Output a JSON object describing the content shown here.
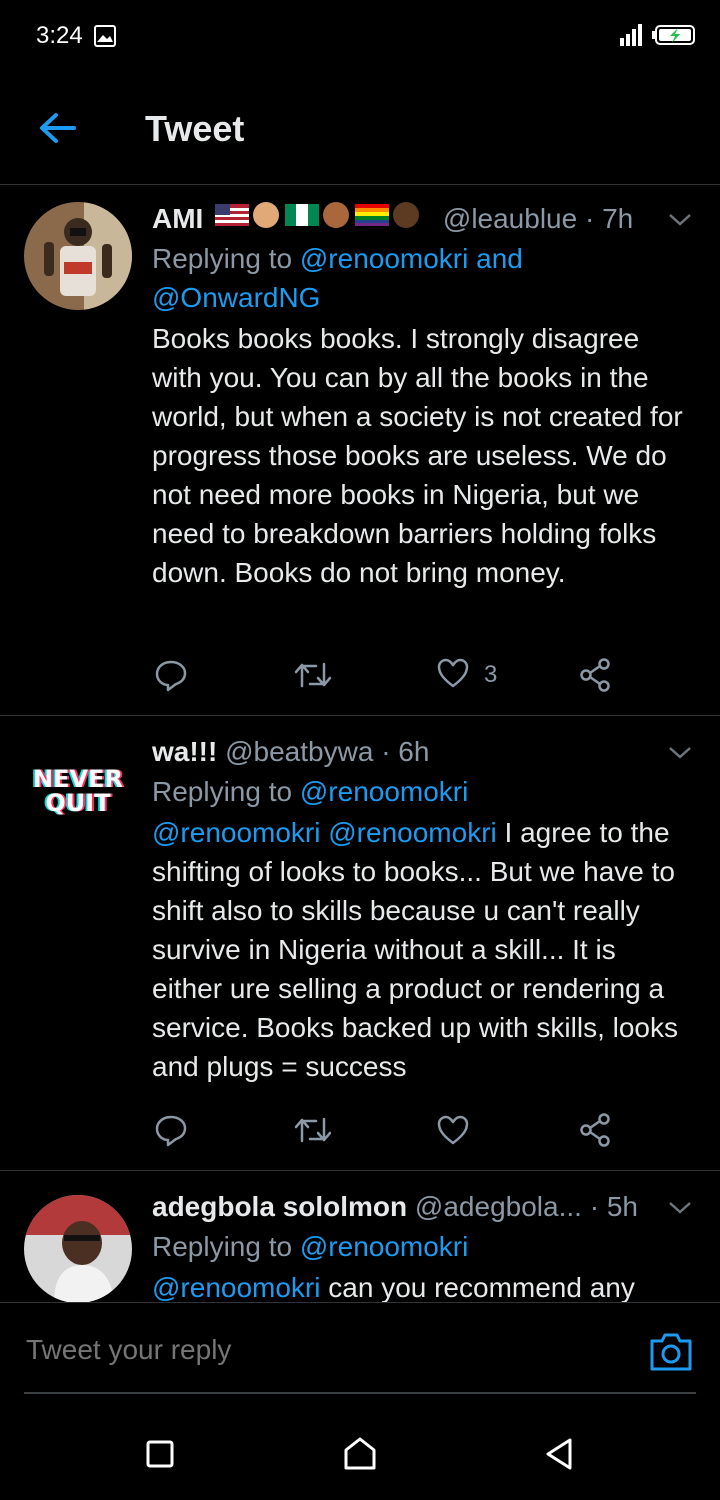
{
  "status_bar": {
    "time": "3:24"
  },
  "header": {
    "title": "Tweet"
  },
  "tweets": [
    {
      "name": "AMI",
      "handle": "@leaublue",
      "separator": "·",
      "time": "7h",
      "replying_prefix": "Replying to",
      "replying_to": "@renoomokri and\n@OnwardNG",
      "body": "Books books books. I strongly disagree with you. You can by all the books in the world, but when a society is not created for progress those books are useless. We do not need more books in Nigeria, but we need to breakdown barriers holding folks down. Books do not bring money.",
      "like_count": "3",
      "avatar_icon": "person-photo-avatar"
    },
    {
      "name": "wa!!!",
      "handle": "@beatbywa",
      "separator": "·",
      "time": "6h",
      "replying_prefix": "Replying to",
      "replying_to": "@renoomokri",
      "body_mention": "@renoomokri @renoomokri",
      "body": " I agree to the shifting of looks to books... But we have to shift also to skills because u can't really survive in Nigeria without a skill... It is either ure selling a product or rendering a service. Books backed up with skills, looks and plugs = success",
      "avatar_text": [
        "NEVER",
        "QUIT"
      ]
    },
    {
      "name": "adegbola sololmon",
      "handle": "@adegbola...",
      "separator": "·",
      "time": "5h",
      "replying_prefix": "Replying to",
      "replying_to": "@renoomokri",
      "body_mention": "@renoomokri",
      "body": " can you recommend any",
      "avatar_icon": "person-photo-avatar"
    }
  ],
  "reply_bar": {
    "placeholder": "Tweet your reply"
  },
  "colors": {
    "accent": "#1d9bf0",
    "background": "#000000",
    "muted": "#8b98a5",
    "divider": "#2f3336"
  }
}
